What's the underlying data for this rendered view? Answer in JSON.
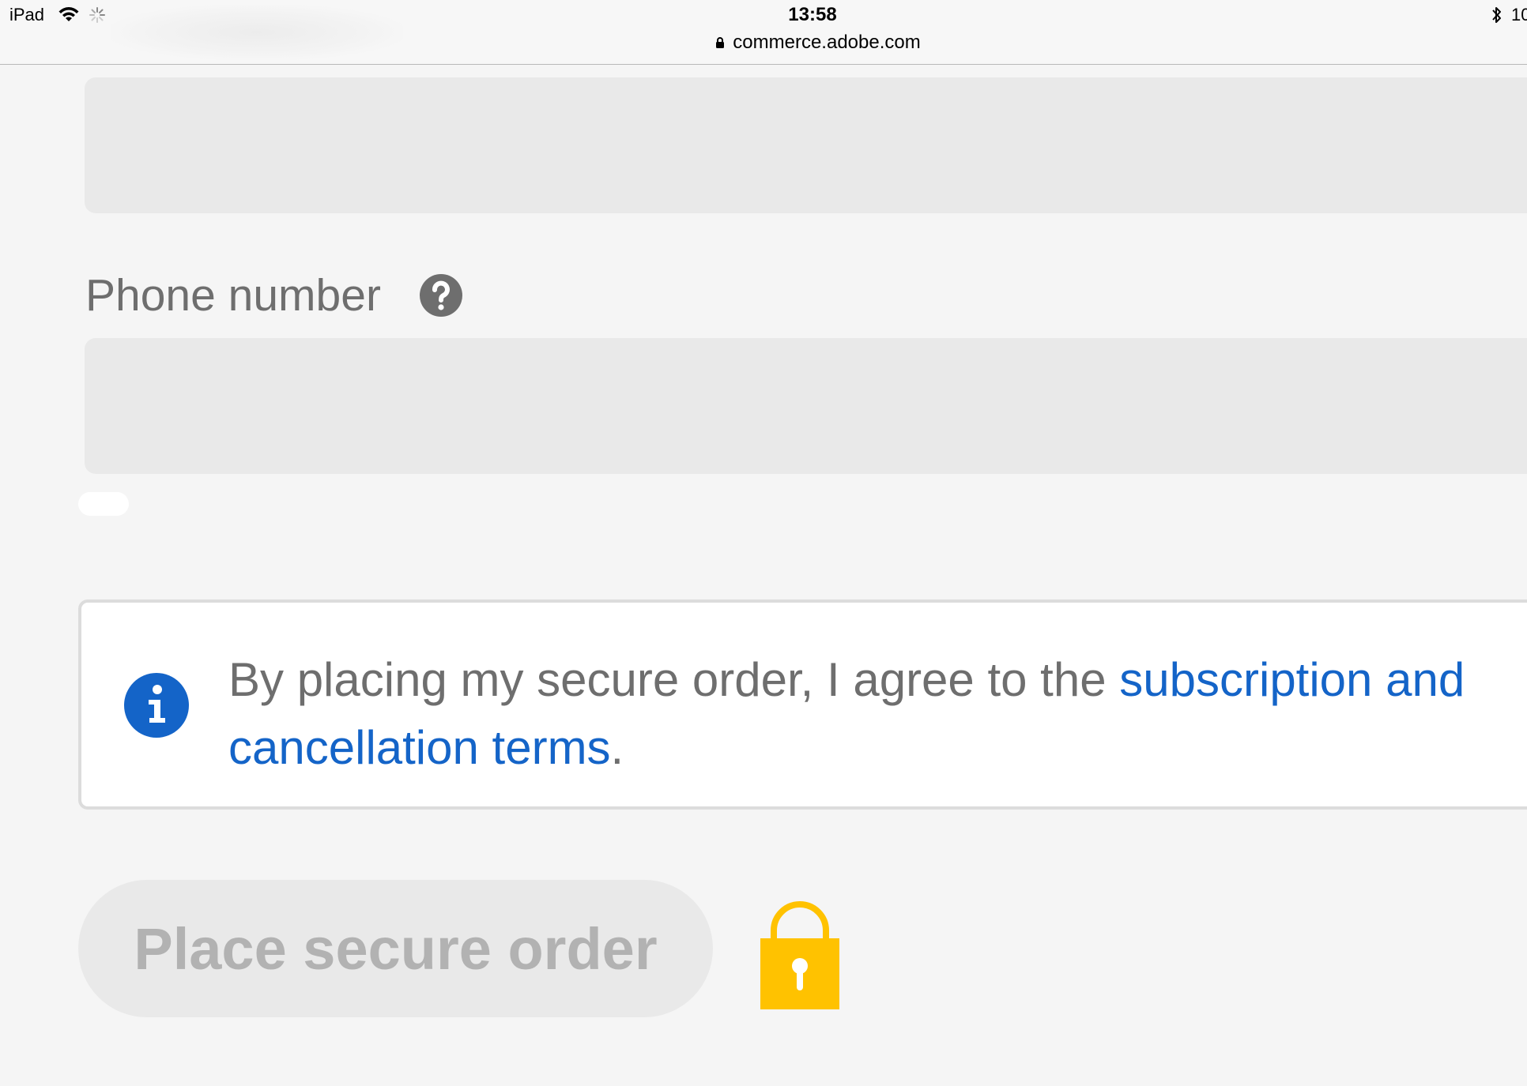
{
  "status_bar": {
    "device": "iPad",
    "time": "13:58",
    "url": "commerce.adobe.com",
    "battery_text": "10",
    "icons": [
      "wifi-icon",
      "loading-spinner-icon",
      "lock-icon",
      "bluetooth-icon"
    ]
  },
  "form": {
    "phone_label": "Phone number",
    "phone_help_icon": "question-circle-icon"
  },
  "notice": {
    "icon": "info-icon",
    "text_prefix": "By placing my secure order, I agree to the ",
    "link_text": "subscription and cancellation terms",
    "text_suffix": "."
  },
  "actions": {
    "place_order_label": "Place secure order",
    "secure_icon": "padlock-icon"
  },
  "colors": {
    "background": "#f5f5f5",
    "input_fill": "#e9e9e9",
    "link": "#1464c8",
    "info_icon": "#1464c8",
    "padlock": "#ffc200",
    "button_text_disabled": "#b2b2b2",
    "label_text": "#6e6e6e"
  }
}
